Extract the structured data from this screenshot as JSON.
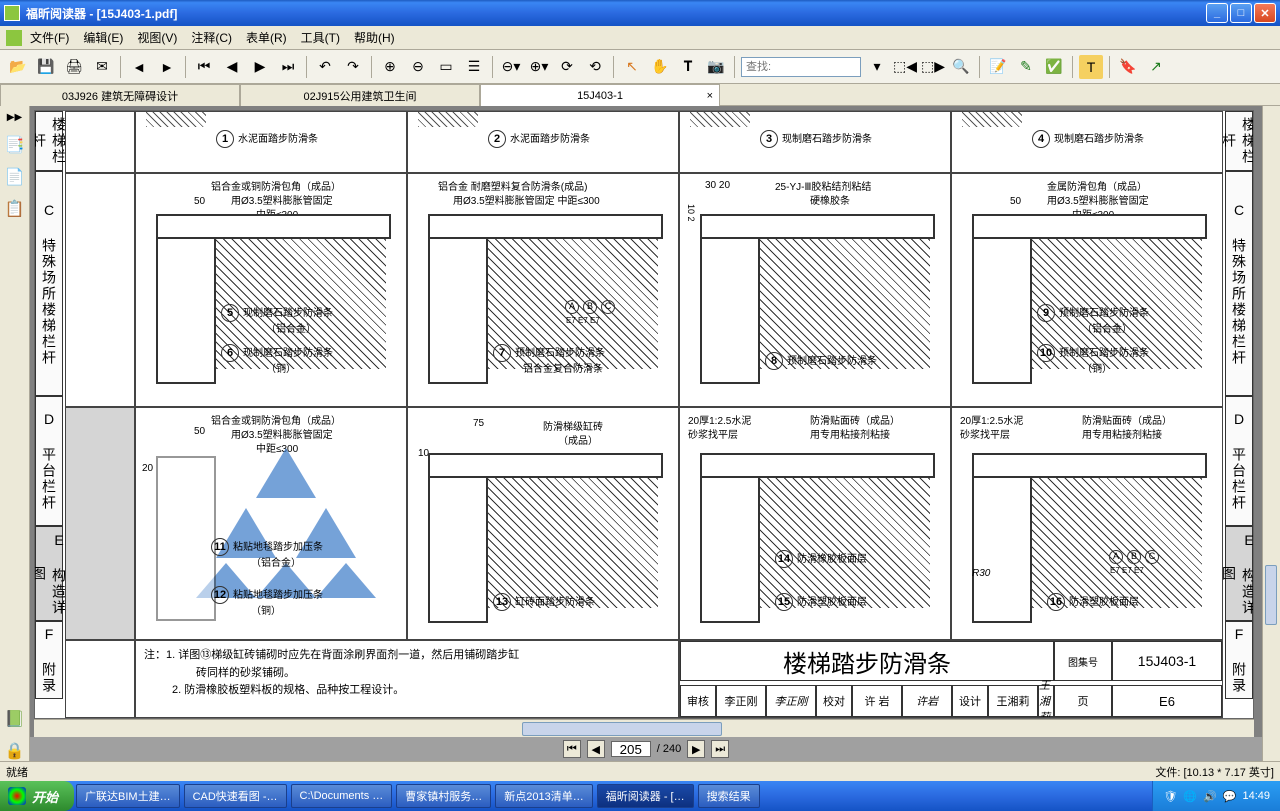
{
  "window": {
    "title": "福昕阅读器 - [15J403-1.pdf]"
  },
  "menu": [
    "文件(F)",
    "编辑(E)",
    "视图(V)",
    "注释(C)",
    "表单(R)",
    "工具(T)",
    "帮助(H)"
  ],
  "toolbar": {
    "search_placeholder": "查找:"
  },
  "tabs": [
    {
      "label": "03J926 建筑无障碍设计"
    },
    {
      "label": "02J915公用建筑卫生间"
    },
    {
      "label": "15J403-1",
      "active": true
    }
  ],
  "vlabels": {
    "left_top": "楼梯栏杆",
    "left_c": "C 特殊场所楼梯栏杆",
    "left_d": "D 平台栏杆",
    "left_e": "E 构造详图",
    "left_f": "F 附录",
    "right_top": "楼梯栏杆",
    "right_c": "C 特殊场所楼梯栏杆",
    "right_d": "D 平台栏杆",
    "right_e": "E 构造详图",
    "right_f": "F 附录"
  },
  "row1": [
    {
      "num": "1",
      "label": "水泥面踏步防滑条"
    },
    {
      "num": "2",
      "label": "水泥面踏步防滑条"
    },
    {
      "num": "3",
      "label": "现制磨石踏步防滑条"
    },
    {
      "num": "4",
      "label": "现制磨石踏步防滑条"
    }
  ],
  "row2": [
    {
      "t1": "铝合金或铜防滑包角（成品）",
      "t2": "用Ø3.5塑料膨胀管固定",
      "t3": "中距≤300",
      "dim": "50",
      "n1": "5",
      "l1": "现制磨石踏步防滑条",
      "l1b": "（铝合金）",
      "n2": "6",
      "l2": "现制磨石踏步防滑条",
      "l2b": "（铜）"
    },
    {
      "t1": "铝合金 耐磨塑料复合防滑条(成品)",
      "t2": "用Ø3.5塑料膨胀管固定 中距≤300",
      "n1": "7",
      "l1": "预制磨石踏步防滑条",
      "l1b": "铝合金复合防滑条",
      "abc": "A B C",
      "e7": "E7 E7 E7"
    },
    {
      "t1": "25-YJ-Ⅲ胶粘结剂粘结",
      "t2": "硬橡胶条",
      "dim": "30  20",
      "dv": "10 2",
      "n1": "8",
      "l1": "预制磨石踏步防滑条"
    },
    {
      "t1": "金属防滑包角（成品）",
      "t2": "用Ø3.5塑料膨胀管固定",
      "t3": "中距≤300",
      "dim": "50",
      "n1": "9",
      "l1": "预制磨石踏步防滑条",
      "l1b": "（铝合金）",
      "n2": "10",
      "l2": "预制磨石踏步防滑条",
      "l2b": "（铜）"
    }
  ],
  "row3": [
    {
      "t1": "铝合金或铜防滑包角（成品）",
      "t2": "用Ø3.5塑料膨胀管固定",
      "t3": "中距≤300",
      "dim": "50",
      "dv": "20",
      "n1": "11",
      "l1": "粘贴地毯踏步加压条",
      "l1b": "（铝合金）",
      "n2": "12",
      "l2": "粘贴地毯踏步加压条",
      "l2b": "（铜）"
    },
    {
      "t1": "防滑梯级缸砖",
      "t2": "（成品）",
      "dim": "75",
      "dv": "10",
      "n1": "13",
      "l1": "缸砖面踏步防滑条"
    },
    {
      "t1": "20厚1:2.5水泥",
      "t2": "砂浆找平层",
      "t3": "防滑贴面砖（成品）",
      "t4": "用专用粘接剂粘接",
      "n1": "14",
      "l1": "防滑橡胶板面层",
      "n2": "15",
      "l2": "防滑塑胶板面层"
    },
    {
      "t1": "20厚1:2.5水泥",
      "t2": "砂浆找平层",
      "t3": "防滑贴面砖（成品）",
      "t4": "用专用粘接剂粘接",
      "r": "R30",
      "abc": "A B C",
      "e7": "E7 E7 E7",
      "n1": "16",
      "l1": "防滑塑胶板面层"
    }
  ],
  "notes": {
    "n1": "注：1. 详图⑬梯级缸砖铺砌时应先在背面涂刷界面剂一道，然后用铺砌踏步缸",
    "n1b": "砖同样的砂浆铺砌。",
    "n2": "2. 防滑橡胶板塑料板的规格、品种按工程设计。"
  },
  "titleblock": {
    "title": "楼梯踏步防滑条",
    "atlas_l": "图集号",
    "atlas": "15J403-1",
    "check_l": "审核",
    "check": "李正刚",
    "check_s": "李正刚",
    "proof_l": "校对",
    "proof": "许 岩",
    "proof_s": "许岩",
    "design_l": "设计",
    "design": "王湘莉",
    "design_s": "王湘莉",
    "page_l": "页",
    "page": "E6"
  },
  "pager": {
    "current": "205",
    "total": "/ 240"
  },
  "status": {
    "ready": "就绪",
    "filesize": "文件: [10.13 * 7.17 英寸]"
  },
  "taskbar": {
    "start": "开始",
    "tasks": [
      "广联达BIM土建…",
      "CAD快速看图 -…",
      "C:\\Documents …",
      "曹家镇村服务…",
      "新点2013清单…",
      "福昕阅读器 - […",
      "搜索结果"
    ],
    "time": "14:49"
  }
}
